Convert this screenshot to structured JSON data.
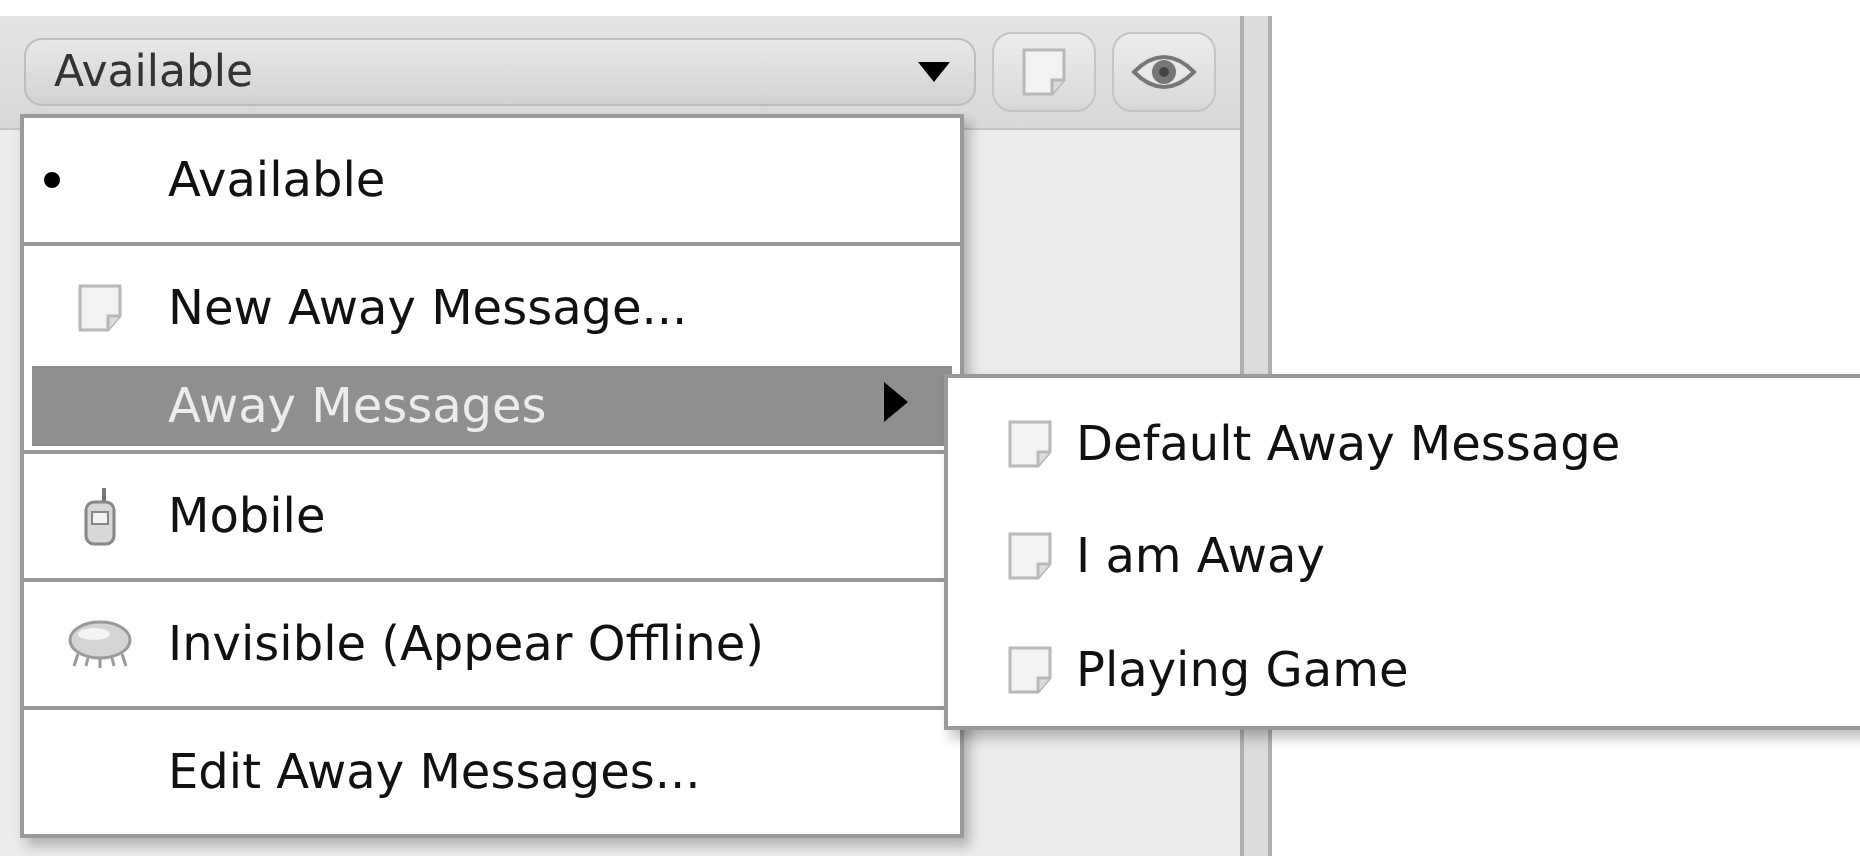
{
  "status_selector": {
    "value": "Available"
  },
  "status_menu": {
    "groups": [
      {
        "items": [
          {
            "kind": "radio",
            "label": "Available",
            "checked": true
          }
        ]
      },
      {
        "items": [
          {
            "kind": "note",
            "label": "New Away Message..."
          },
          {
            "kind": "submenu",
            "label": "Away Messages",
            "selected": true
          }
        ]
      },
      {
        "items": [
          {
            "kind": "phone",
            "label": "Mobile"
          }
        ]
      },
      {
        "items": [
          {
            "kind": "bubble",
            "label": "Invisible (Appear Offline)"
          }
        ]
      },
      {
        "items": [
          {
            "kind": "plain",
            "label": "Edit Away Messages..."
          }
        ]
      }
    ]
  },
  "away_submenu": {
    "items": [
      {
        "label": "Default Away Message"
      },
      {
        "label": "I am Away"
      },
      {
        "label": "Playing Game"
      }
    ]
  }
}
